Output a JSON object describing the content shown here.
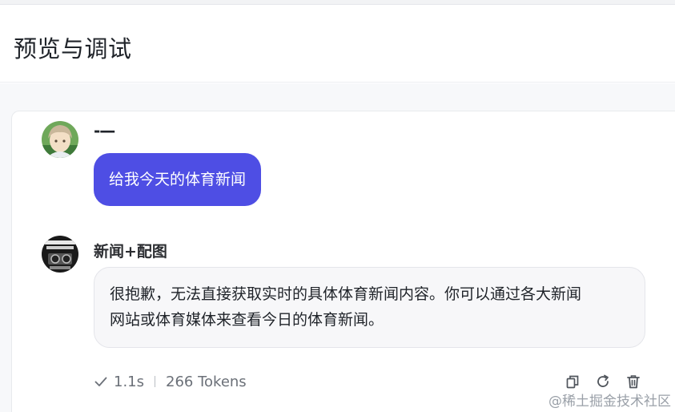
{
  "header": {
    "title": "预览与调试"
  },
  "messages": {
    "user": {
      "name": "-—",
      "text": "给我今天的体育新闻"
    },
    "bot": {
      "name": "新闻+配图",
      "line1": "很抱歉，无法直接获取实时的具体体育新闻内容。你可以通过各大新闻",
      "line2": "网站或体育媒体来查看今日的体育新闻。"
    }
  },
  "meta": {
    "duration": "1.1s",
    "tokens": "266 Tokens"
  },
  "actions": {
    "icons": [
      "copy-icon",
      "refresh-icon",
      "delete-icon"
    ]
  },
  "watermark": "@稀土掘金技术社区",
  "colors": {
    "user_bubble": "#4e4ee4",
    "bot_bubble": "#f7f7f9",
    "text": "#1f2329",
    "meta": "#6b7078"
  }
}
